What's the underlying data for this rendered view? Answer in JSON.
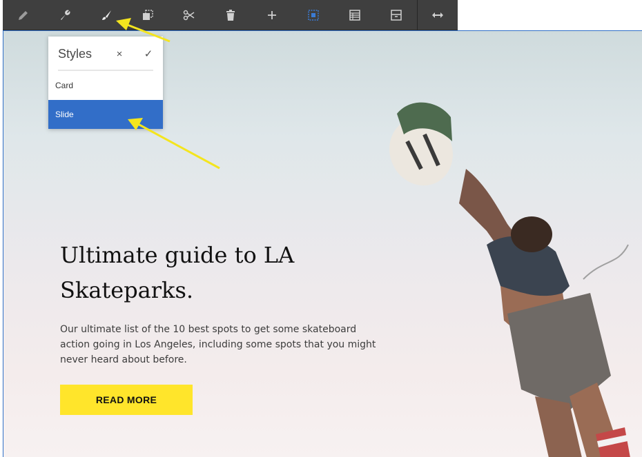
{
  "toolbar": {
    "buttons": [
      {
        "name": "edit-icon"
      },
      {
        "name": "configure-icon"
      },
      {
        "name": "styles-brush-icon"
      },
      {
        "name": "copy-icon"
      },
      {
        "name": "cut-icon"
      },
      {
        "name": "delete-icon"
      },
      {
        "name": "insert-icon"
      },
      {
        "name": "select-parent-icon"
      },
      {
        "name": "grid-layout-icon"
      },
      {
        "name": "group-icon"
      },
      {
        "name": "resize-icon"
      }
    ]
  },
  "styles_popover": {
    "title": "Styles",
    "close_icon": "×",
    "confirm_icon": "✓",
    "options": [
      {
        "label": "Card",
        "selected": false
      },
      {
        "label": "Slide",
        "selected": true
      }
    ]
  },
  "hero": {
    "headline": "Ultimate guide to LA Skateparks.",
    "description": "Our ultimate list of the 10 best spots to get some skateboard action going in Los Angeles, including some spots that you might never heard about before.",
    "cta_label": "READ MORE"
  },
  "colors": {
    "toolbar_bg": "#3f3f3f",
    "accent_blue": "#326ec8",
    "cta_yellow": "#ffe52b",
    "annotation_arrow": "#f4e51e"
  }
}
